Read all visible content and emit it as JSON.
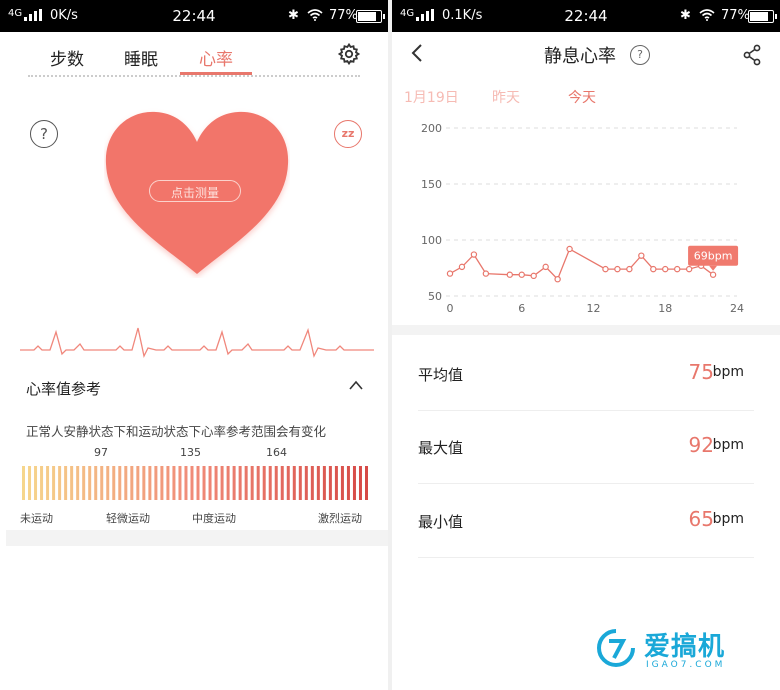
{
  "left": {
    "status": {
      "network": "4G",
      "speed": "0K/s",
      "time": "22:44",
      "battery": "77%"
    },
    "tabs": [
      "步数",
      "睡眠",
      "心率"
    ],
    "active_tab": "心率",
    "measure_button": "点击测量",
    "help_symbol": "?",
    "sleep_symbol": "zz",
    "reference": {
      "title": "心率值参考",
      "description": "正常人安静状态下和运动状态下心率参考范围会有变化",
      "ticks": [
        "97",
        "135",
        "164"
      ],
      "zones": [
        "未运动",
        "轻微运动",
        "中度运动",
        "激烈运动"
      ]
    },
    "colors": {
      "accent": "#e8776c",
      "heart": "#f2756b"
    }
  },
  "right": {
    "status": {
      "network": "4G",
      "speed": "0.1K/s",
      "time": "22:44",
      "battery": "77%"
    },
    "title": "静息心率",
    "help_symbol": "?",
    "day_tabs": [
      "1月19日",
      "昨天",
      "今天"
    ],
    "active_day": "今天",
    "stats": [
      {
        "label": "平均值",
        "value": "75",
        "unit": "bpm"
      },
      {
        "label": "最大值",
        "value": "92",
        "unit": "bpm"
      },
      {
        "label": "最小值",
        "value": "65",
        "unit": "bpm"
      }
    ],
    "watermark": {
      "name": "爱搞机",
      "domain": "IGAO7.COM"
    }
  },
  "chart_data": {
    "type": "line",
    "y_ticks": [
      "200",
      "150",
      "100",
      "50"
    ],
    "x_ticks": [
      "0",
      "6",
      "12",
      "18",
      "24"
    ],
    "ylim": [
      50,
      200
    ],
    "xlim": [
      0,
      24
    ],
    "grid": true,
    "x": [
      0,
      1,
      2,
      3,
      5,
      6,
      7,
      8,
      9,
      10,
      13,
      14,
      15,
      16,
      17,
      18,
      19,
      20,
      21,
      22
    ],
    "values": [
      70,
      76,
      87,
      70,
      69,
      69,
      68,
      76,
      65,
      92,
      74,
      74,
      74,
      86,
      74,
      74,
      74,
      74,
      77,
      69
    ],
    "callout": {
      "x": 22,
      "value": 69,
      "label": "69bpm"
    }
  }
}
